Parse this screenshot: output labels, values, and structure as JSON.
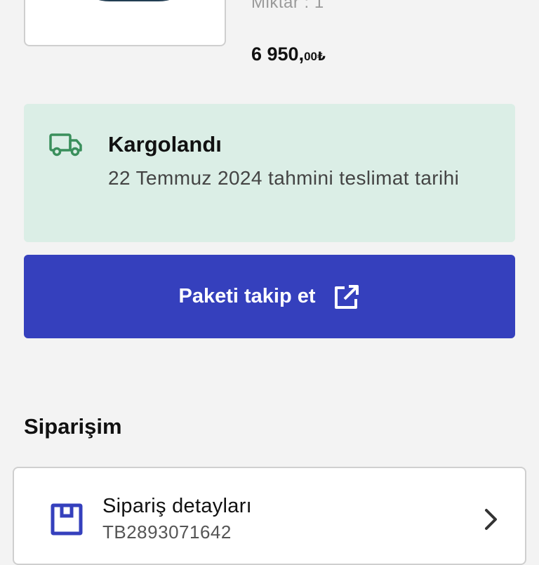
{
  "product": {
    "quantity_text": "Miktar : 1",
    "price_main": "6 950,",
    "price_fraction": "00₺"
  },
  "shipment": {
    "status": "Kargolandı",
    "estimate": "22 Temmuz 2024 tahmini teslimat tarihi",
    "icon": "truck-icon",
    "accent_color": "#3a8f5c",
    "background_color": "#dbeee6"
  },
  "track_button": {
    "label": "Paketi takip et",
    "icon": "external-link-icon",
    "color": "#3540bd"
  },
  "order_section": {
    "title": "Siparişim",
    "details": {
      "title": "Sipariş detayları",
      "number": "TB2893071642",
      "icon": "box-icon",
      "icon_color": "#3540bd"
    }
  }
}
